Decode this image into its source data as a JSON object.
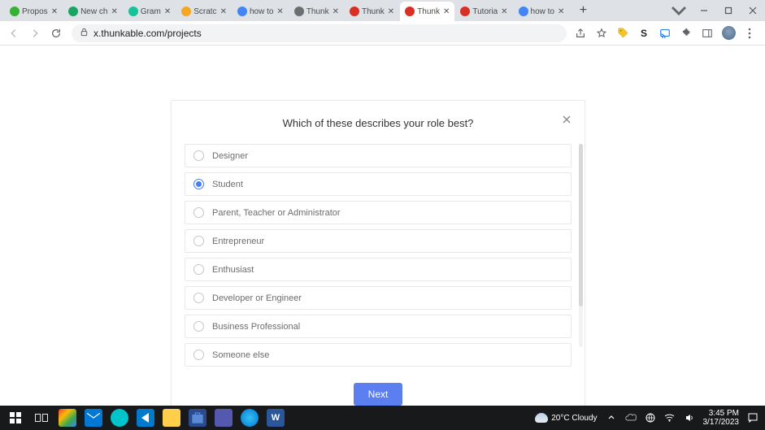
{
  "browser": {
    "tabs": [
      {
        "label": "Propos",
        "favicon": "#34b233"
      },
      {
        "label": "New ch",
        "favicon": "#1aa564"
      },
      {
        "label": "Gram",
        "favicon": "#15c39a"
      },
      {
        "label": "Scratc",
        "favicon": "#f6a623"
      },
      {
        "label": "how to",
        "favicon": "#4285f4"
      },
      {
        "label": "Thunk",
        "favicon": "#6e6e6e"
      },
      {
        "label": "Thunk",
        "favicon": "#d93025"
      },
      {
        "label": "Thunk",
        "favicon": "#d93025"
      },
      {
        "label": "Tutoria",
        "favicon": "#d93025"
      },
      {
        "label": "how to",
        "favicon": "#4285f4"
      }
    ],
    "active_tab_index": 7,
    "url": "x.thunkable.com/projects",
    "ext_letter": "S"
  },
  "modal": {
    "title": "Which of these describes your role best?",
    "options": [
      "Designer",
      "Student",
      "Parent, Teacher or Administrator",
      "Entrepreneur",
      "Enthusiast",
      "Developer or Engineer",
      "Business Professional",
      "Someone else"
    ],
    "selected_index": 1,
    "next_label": "Next"
  },
  "taskbar": {
    "weather_text": "20°C  Cloudy",
    "time": "3:45 PM",
    "date": "3/17/2023",
    "word_letter": "W"
  }
}
